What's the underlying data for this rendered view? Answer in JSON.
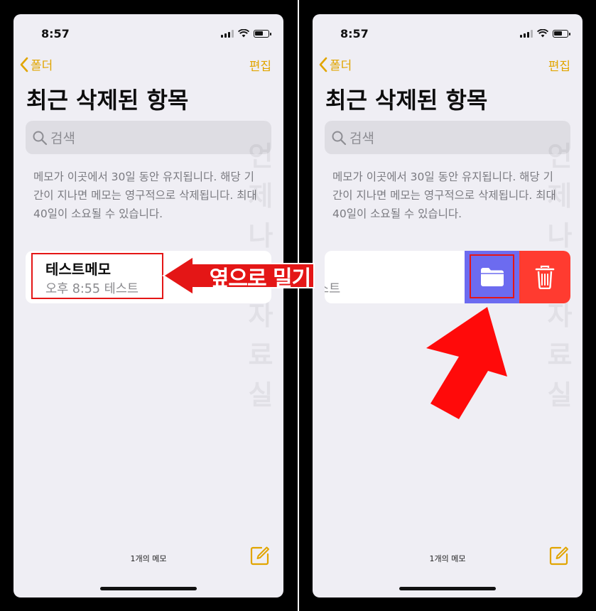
{
  "status": {
    "time": "8:57"
  },
  "nav": {
    "back_label": "폴더",
    "edit_label": "편집"
  },
  "page": {
    "title": "최근 삭제된 항목"
  },
  "search": {
    "placeholder": "검색"
  },
  "info": {
    "text": "메모가 이곳에서 30일 동안 유지됩니다. 해당 기간이 지나면 메모는 영구적으로 삭제됩니다. 최대 40일이 소요될 수 있습니다."
  },
  "note": {
    "title": "테스트메모",
    "subtitle": "오후 8:55  테스트",
    "swiped_subtitle": "스트"
  },
  "footer": {
    "count": "1개의 메모"
  },
  "annotation": {
    "swipe_label": "옆으로 밀기"
  },
  "watermark": "언제나 웹자료실",
  "colors": {
    "accent": "#e1a500",
    "folder_action": "#6c6bf0",
    "delete_action": "#ff3b30",
    "annotation_red": "#e41616"
  }
}
